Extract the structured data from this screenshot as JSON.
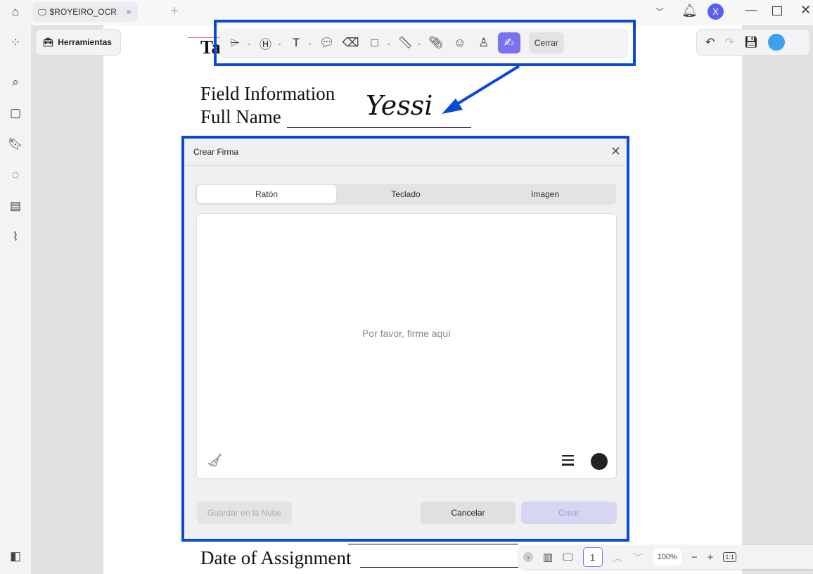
{
  "tab": {
    "title": "$ROYEIRO_OCR"
  },
  "user": {
    "avatar_letter": "X"
  },
  "tools_button": "Herramientas",
  "toolbar": {
    "close_label": "Cerrar"
  },
  "document": {
    "title_fragment": "Ta",
    "line1": "Field Information",
    "line2": "Full Name",
    "signature": "Yessi",
    "line_bottom": "Date of Assignment"
  },
  "dialog": {
    "title": "Crear Firma",
    "tabs": [
      "Ratón",
      "Teclado",
      "Imagen"
    ],
    "placeholder": "Por favor, firme aquí",
    "save_cloud": "Guardar en la Nube",
    "cancel": "Cancelar",
    "create": "Crear"
  },
  "bottom": {
    "page": "1",
    "zoom": "100%"
  },
  "colors": {
    "accent": "#7c72f0",
    "highlight": "#0a4bd6"
  }
}
